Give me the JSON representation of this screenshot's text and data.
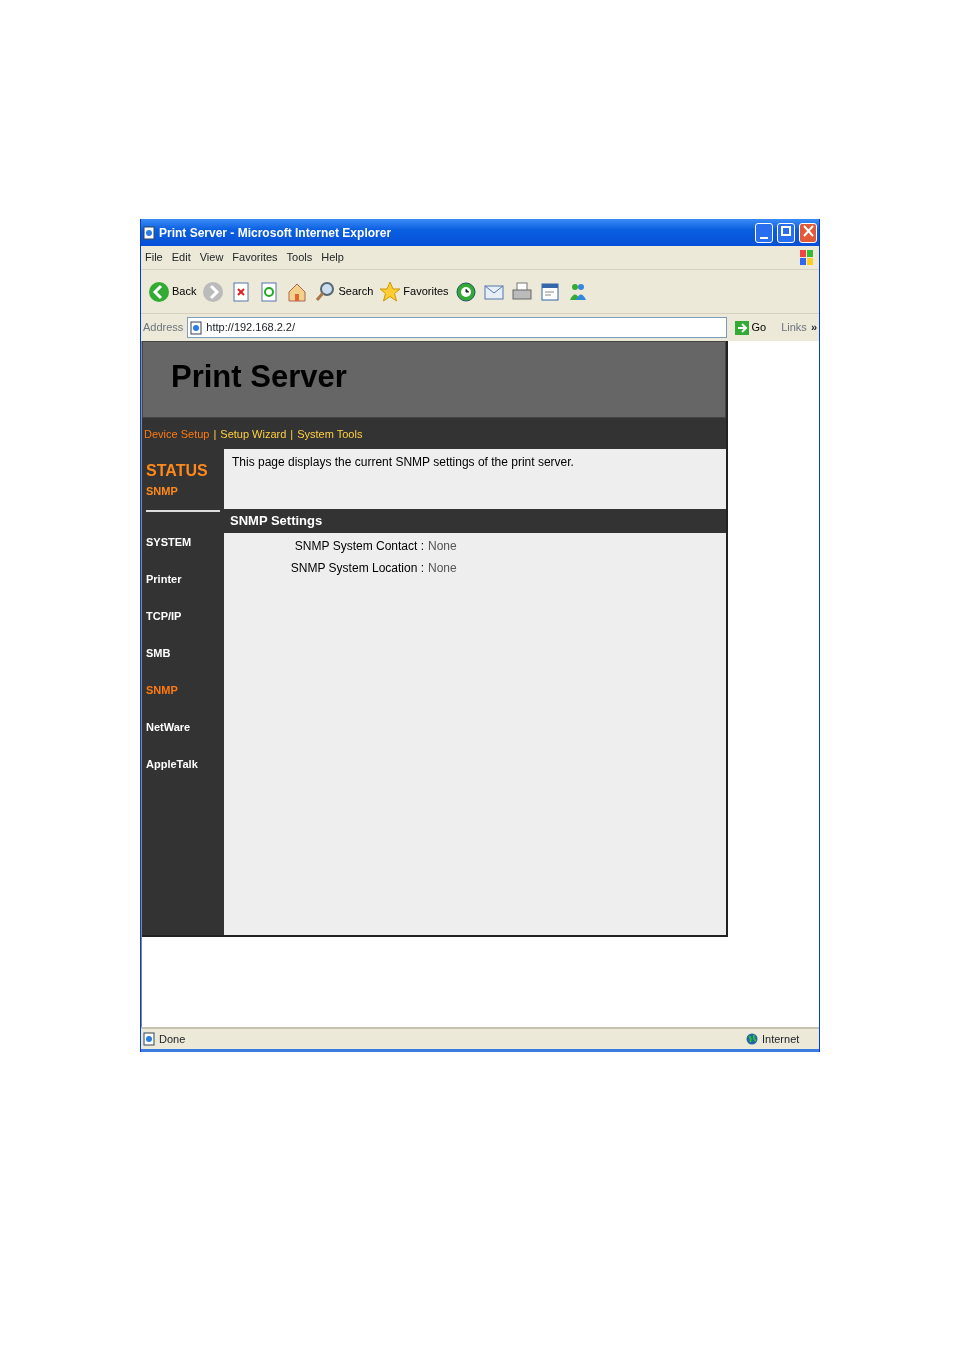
{
  "window": {
    "title": "Print Server - Microsoft Internet Explorer"
  },
  "menu": [
    "File",
    "Edit",
    "View",
    "Favorites",
    "Tools",
    "Help"
  ],
  "toolbar": [
    {
      "kind": "back",
      "label": "Back"
    },
    {
      "kind": "forward"
    },
    {
      "kind": "stop"
    },
    {
      "kind": "refresh"
    },
    {
      "kind": "home"
    },
    {
      "kind": "search",
      "label": "Search"
    },
    {
      "kind": "favorites",
      "label": "Favorites"
    },
    {
      "kind": "history"
    },
    {
      "kind": "mail"
    },
    {
      "kind": "print"
    },
    {
      "kind": "edit"
    },
    {
      "kind": "messenger"
    }
  ],
  "address_bar": {
    "label": "Address",
    "value": "http://192.168.2.2/",
    "go": "Go",
    "links": "Links",
    "more": "»"
  },
  "page": {
    "title": "Print Server",
    "nav_separator": "|",
    "nav": [
      {
        "label": "Device Setup",
        "selected": true
      },
      {
        "label": "Setup Wizard",
        "selected": false
      },
      {
        "label": "System Tools",
        "selected": false
      }
    ],
    "sidebar": {
      "heading": "STATUS",
      "subheading": "SNMP",
      "items": [
        {
          "label": "SYSTEM",
          "selected": false
        },
        {
          "label": "Printer",
          "selected": false
        },
        {
          "label": "TCP/IP",
          "selected": false
        },
        {
          "label": "SMB",
          "selected": false
        },
        {
          "label": "SNMP",
          "selected": true
        },
        {
          "label": "NetWare",
          "selected": false
        },
        {
          "label": "AppleTalk",
          "selected": false
        }
      ]
    },
    "intro": "This page displays the current SNMP settings of the print server.",
    "section_title": "SNMP Settings",
    "fields": [
      {
        "label": "SNMP System Contact :",
        "value": "None"
      },
      {
        "label": "SNMP System Location :",
        "value": "None"
      }
    ]
  },
  "status_bar": {
    "text": "Done",
    "zone": "Internet"
  }
}
